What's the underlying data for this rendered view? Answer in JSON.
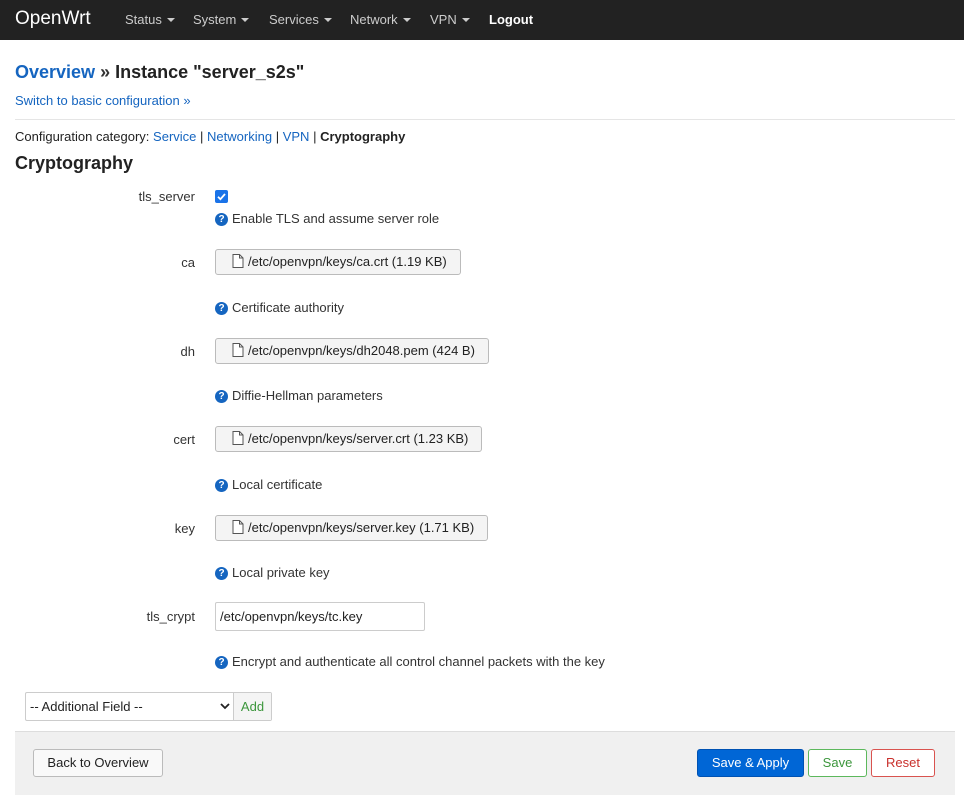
{
  "navbar": {
    "brand": "OpenWrt",
    "menus": [
      "Status",
      "System",
      "Services",
      "Network",
      "VPN"
    ],
    "logout": "Logout"
  },
  "header": {
    "overview_link": "Overview",
    "separator": "»",
    "instance_title": "Instance \"server_s2s\"",
    "basic_config_link": "Switch to basic configuration »"
  },
  "category": {
    "prefix": "Configuration category:",
    "items": [
      "Service",
      "Networking",
      "VPN"
    ],
    "divider": "|",
    "current": "Cryptography"
  },
  "section": {
    "title": "Cryptography"
  },
  "fields": {
    "tls_server": {
      "label": "tls_server",
      "checked": true,
      "help": "Enable TLS and assume server role"
    },
    "ca": {
      "label": "ca",
      "value": "/etc/openvpn/keys/ca.crt (1.19 KB)",
      "help": "Certificate authority"
    },
    "dh": {
      "label": "dh",
      "value": "/etc/openvpn/keys/dh2048.pem (424 B)",
      "help": "Diffie-Hellman parameters"
    },
    "cert": {
      "label": "cert",
      "value": "/etc/openvpn/keys/server.crt (1.23 KB)",
      "help": "Local certificate"
    },
    "key": {
      "label": "key",
      "value": "/etc/openvpn/keys/server.key (1.71 KB)",
      "help": "Local private key"
    },
    "tls_crypt": {
      "label": "tls_crypt",
      "value": "/etc/openvpn/keys/tc.key",
      "help": "Encrypt and authenticate all control channel packets with the key"
    }
  },
  "help_icon_glyph": "?",
  "additional": {
    "select_value": "-- Additional Field --",
    "add_label": "Add"
  },
  "footer": {
    "back_label": "Back to Overview",
    "save_apply_label": "Save & Apply",
    "save_label": "Save",
    "reset_label": "Reset"
  },
  "colors": {
    "navbar_bg": "#222222",
    "link": "#1565c0",
    "primary": "#0066d6",
    "success": "#3c963c",
    "danger": "#c9302c"
  }
}
